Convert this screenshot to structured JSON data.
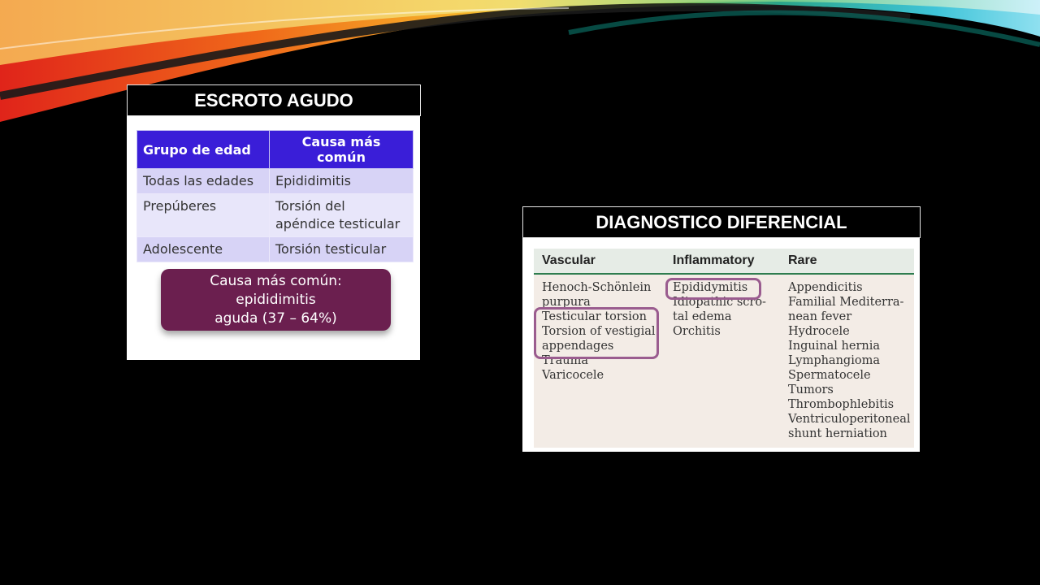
{
  "slide": {
    "title_left": "ESCROTO AGUDO",
    "title_right": "DIAGNOSTICO DIFERENCIAL"
  },
  "age_table": {
    "headers": [
      "Grupo de edad",
      "Causa más común"
    ],
    "rows": [
      {
        "group": "Todas las edades",
        "cause_lines": [
          "Epididimitis"
        ]
      },
      {
        "group": "Prepúberes",
        "cause_lines": [
          "Torsión del",
          "apéndice testicular"
        ]
      },
      {
        "group": "Adolescente",
        "cause_lines": [
          "Torsión testicular"
        ]
      }
    ],
    "note_lines": [
      "Causa más común: epididimitis",
      "aguda (37 – 64%)"
    ]
  },
  "ddx_table": {
    "headers": [
      "Vascular",
      "Inflammatory",
      "Rare"
    ],
    "vascular": [
      "Henoch-Schönlein",
      "purpura",
      "Testicular torsion",
      "Torsion of vestigial",
      "appendages",
      "Trauma",
      "Varicocele"
    ],
    "inflammatory": [
      "Epididymitis",
      "Idiopathic scro-",
      "tal edema",
      "Orchitis"
    ],
    "rare": [
      "Appendicitis",
      "Familial Mediterra-",
      "nean fever",
      "Hydrocele",
      "Inguinal hernia",
      "Lymphangioma",
      "Spermatocele",
      "Tumors",
      "Thrombophlebitis",
      "Ventriculoperitoneal",
      "shunt herniation"
    ],
    "highlight_color": "#9a5c8f",
    "header_rule_color": "#2e7d4f"
  },
  "colors": {
    "background": "#000000",
    "table_header": "#3a1ed8",
    "table_cell": "#d7d3f6",
    "note_box": "#6b1f4f"
  }
}
